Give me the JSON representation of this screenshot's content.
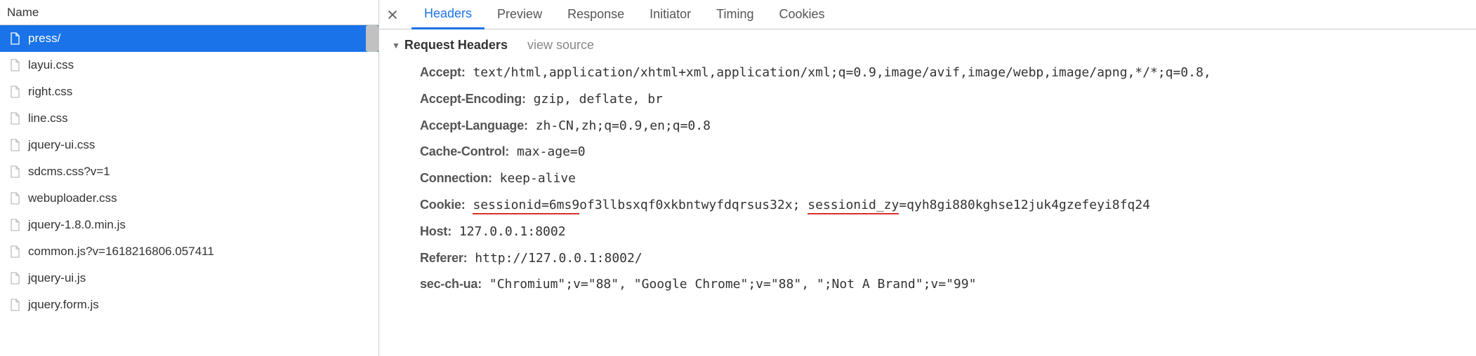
{
  "sidebar": {
    "header_label": "Name",
    "items": [
      {
        "name": "press/",
        "selected": true
      },
      {
        "name": "layui.css",
        "selected": false
      },
      {
        "name": "right.css",
        "selected": false
      },
      {
        "name": "line.css",
        "selected": false
      },
      {
        "name": "jquery-ui.css",
        "selected": false
      },
      {
        "name": "sdcms.css?v=1",
        "selected": false
      },
      {
        "name": "webuploader.css",
        "selected": false
      },
      {
        "name": "jquery-1.8.0.min.js",
        "selected": false
      },
      {
        "name": "common.js?v=1618216806.057411",
        "selected": false
      },
      {
        "name": "jquery-ui.js",
        "selected": false
      },
      {
        "name": "jquery.form.js",
        "selected": false
      }
    ]
  },
  "tabs": {
    "items": [
      {
        "label": "Headers",
        "active": true
      },
      {
        "label": "Preview",
        "active": false
      },
      {
        "label": "Response",
        "active": false
      },
      {
        "label": "Initiator",
        "active": false
      },
      {
        "label": "Timing",
        "active": false
      },
      {
        "label": "Cookies",
        "active": false
      }
    ]
  },
  "section": {
    "title": "Request Headers",
    "view_source": "view source"
  },
  "headers": {
    "accept": {
      "key": "Accept:",
      "value": "text/html,application/xhtml+xml,application/xml;q=0.9,image/avif,image/webp,image/apng,*/*;q=0.8,"
    },
    "accept_encoding": {
      "key": "Accept-Encoding:",
      "value": "gzip, deflate, br"
    },
    "accept_language": {
      "key": "Accept-Language:",
      "value": "zh-CN,zh;q=0.9,en;q=0.8"
    },
    "cache_control": {
      "key": "Cache-Control:",
      "value": "max-age=0"
    },
    "connection": {
      "key": "Connection:",
      "value": "keep-alive"
    },
    "cookie": {
      "key": "Cookie:",
      "part1_underlined": "sessionid=6ms9",
      "part1_rest": "of3llbsxqf0xkbntwyfdqrsus32x; ",
      "part2_underlined": "sessionid_zy",
      "part2_rest": "=qyh8gi880kghse12juk4gzefeyi8fq24"
    },
    "host": {
      "key": "Host:",
      "value": "127.0.0.1:8002"
    },
    "referer": {
      "key": "Referer:",
      "value": "http://127.0.0.1:8002/"
    },
    "sec_ch_ua": {
      "key": "sec-ch-ua:",
      "value": "\"Chromium\";v=\"88\", \"Google Chrome\";v=\"88\", \";Not A Brand\";v=\"99\""
    }
  }
}
